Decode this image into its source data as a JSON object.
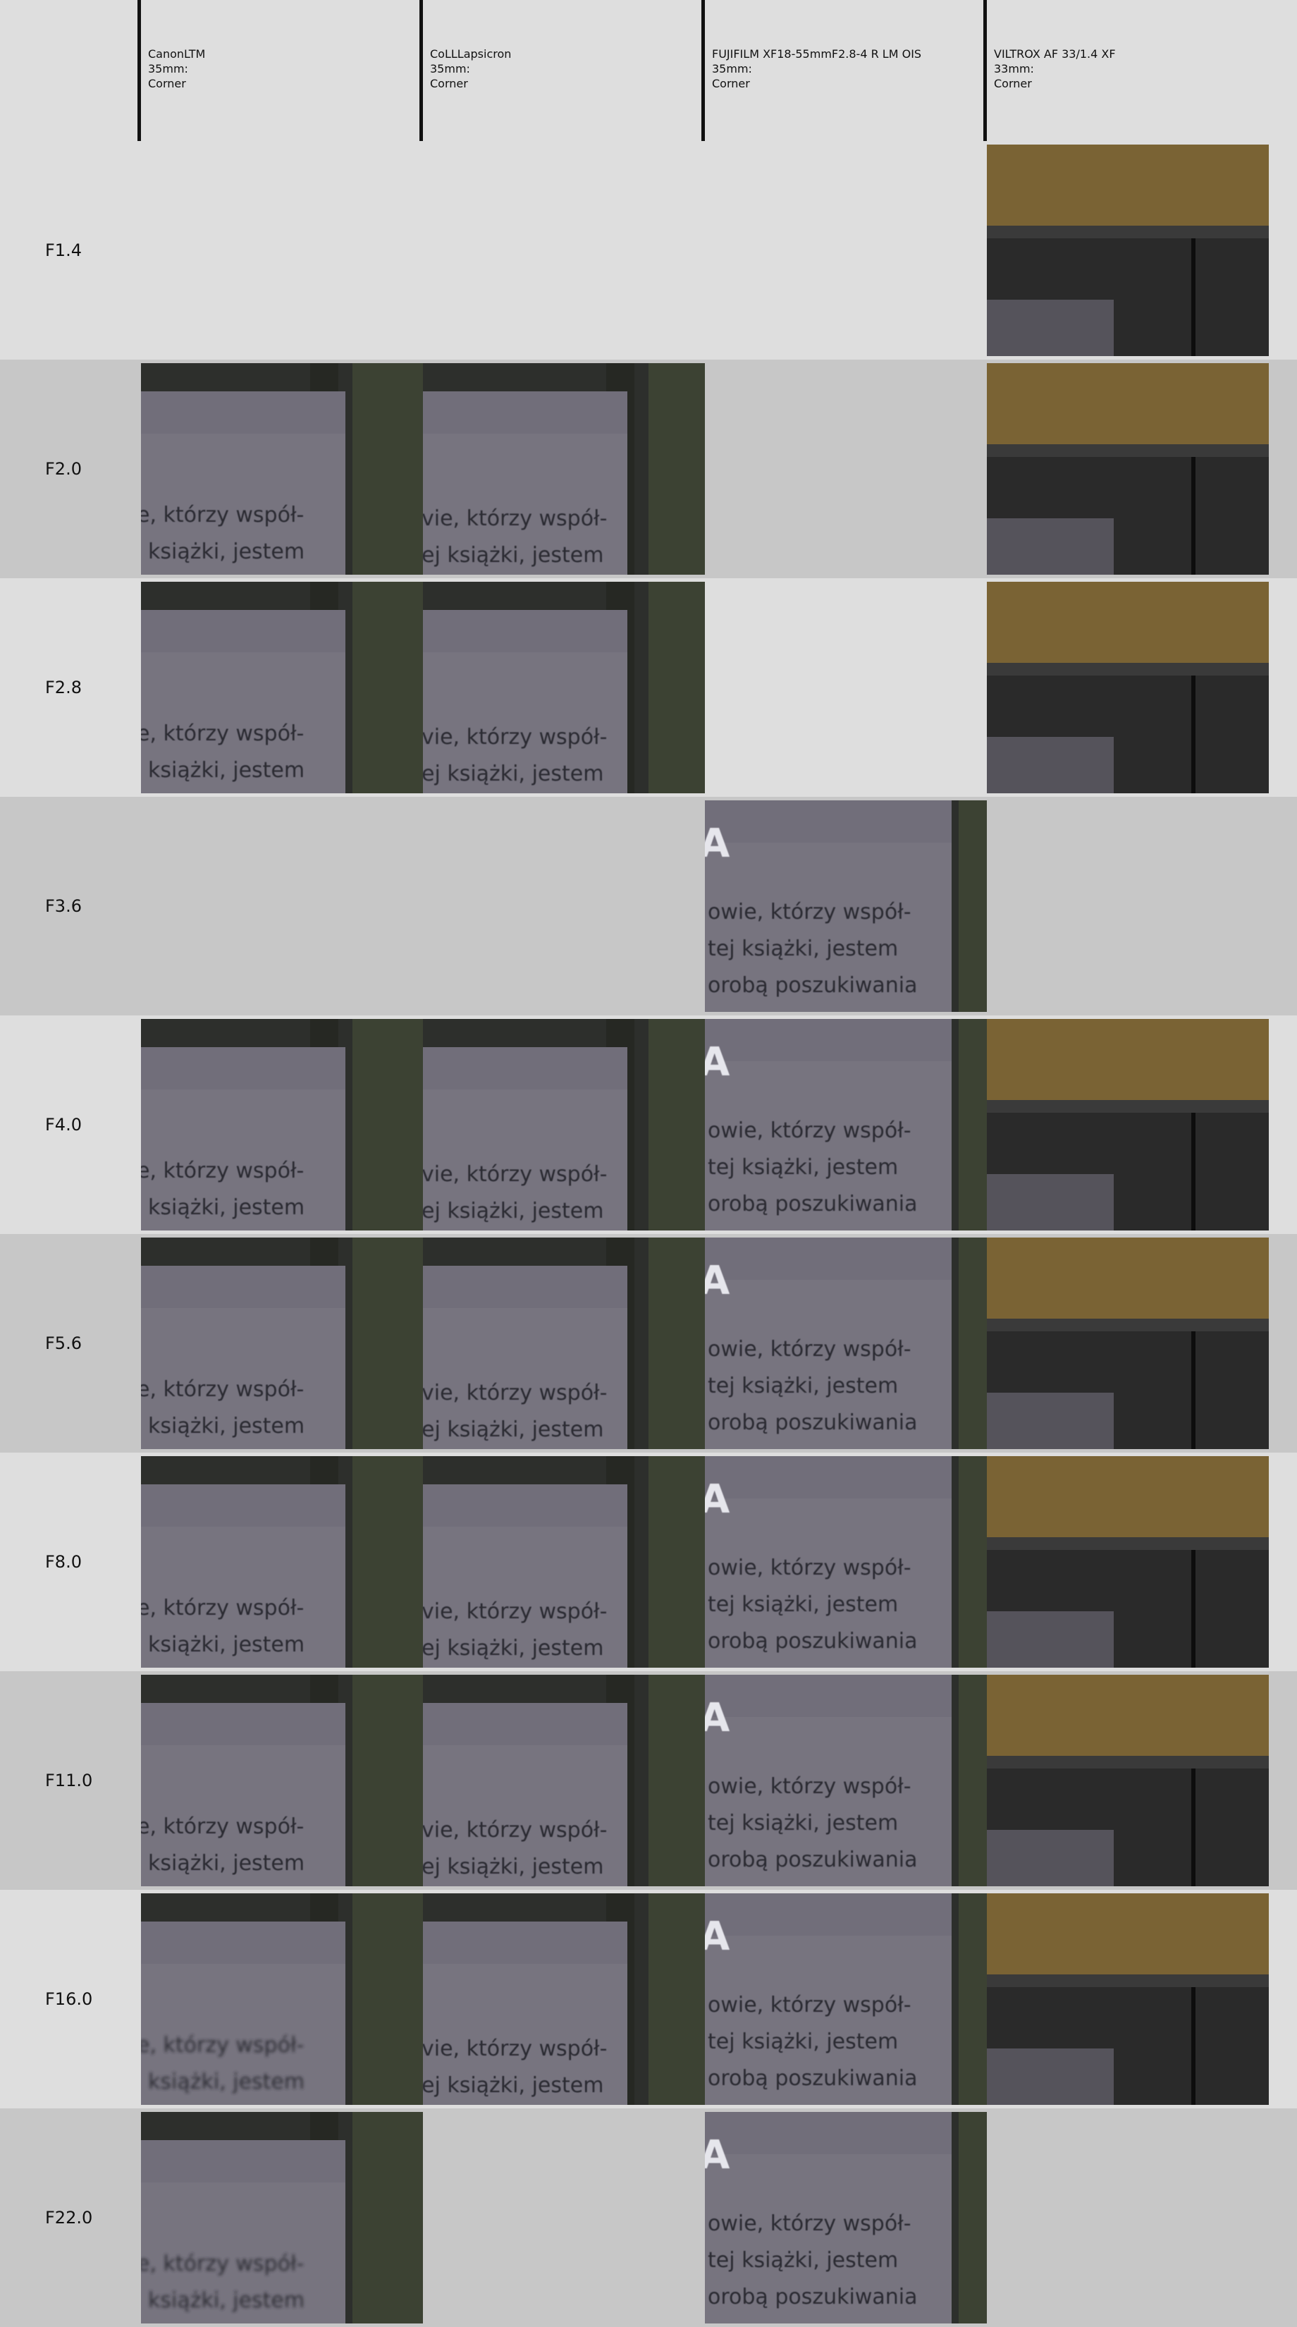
{
  "lenses": [
    {
      "id": "canon",
      "style": "canon",
      "lines": [
        "CanonLTM",
        "35mm:",
        "Corner"
      ]
    },
    {
      "id": "coll",
      "style": "coll",
      "lines": [
        "CoLLLapsicron",
        "35mm:",
        "Corner"
      ]
    },
    {
      "id": "fuji",
      "style": "fuji",
      "lines": [
        "FUJIFILM XF18-55mmF2.8-4 R LM OIS",
        "35mm:",
        "Corner"
      ]
    },
    {
      "id": "viltrox",
      "style": "viltrox",
      "lines": [
        "VILTROX  AF 33/1.4 XF",
        "33mm:",
        "Corner"
      ]
    }
  ],
  "rows": [
    {
      "label": "F1.4",
      "cells": [
        false,
        false,
        false,
        true
      ]
    },
    {
      "label": "F2.0",
      "cells": [
        true,
        true,
        false,
        true
      ]
    },
    {
      "label": "F2.8",
      "cells": [
        true,
        true,
        false,
        true
      ]
    },
    {
      "label": "F3.6",
      "cells": [
        false,
        false,
        true,
        false
      ]
    },
    {
      "label": "F4.0",
      "cells": [
        true,
        true,
        true,
        true
      ]
    },
    {
      "label": "F5.6",
      "cells": [
        true,
        true,
        true,
        true
      ]
    },
    {
      "label": "F8.0",
      "cells": [
        true,
        true,
        true,
        true
      ]
    },
    {
      "label": "F11.0",
      "cells": [
        true,
        true,
        true,
        true
      ]
    },
    {
      "label": "F16.0",
      "cells": [
        true,
        true,
        true,
        true
      ]
    },
    {
      "label": "F22.0",
      "cells": [
        true,
        false,
        true,
        false
      ]
    }
  ],
  "crop_text": {
    "canon": [
      "e, którzy współ-",
      "książki, jestem"
    ],
    "coll": [
      "vie, którzy współ-",
      "ej książki, jestem"
    ],
    "fuji": [
      "A",
      "owie, którzy współ-",
      "tej  książki, jestem",
      "orobą poszukiwania"
    ]
  },
  "colors": {
    "page_light": "#dedede",
    "page_dark": "#c7c7c7",
    "header_rule": "#111111"
  }
}
